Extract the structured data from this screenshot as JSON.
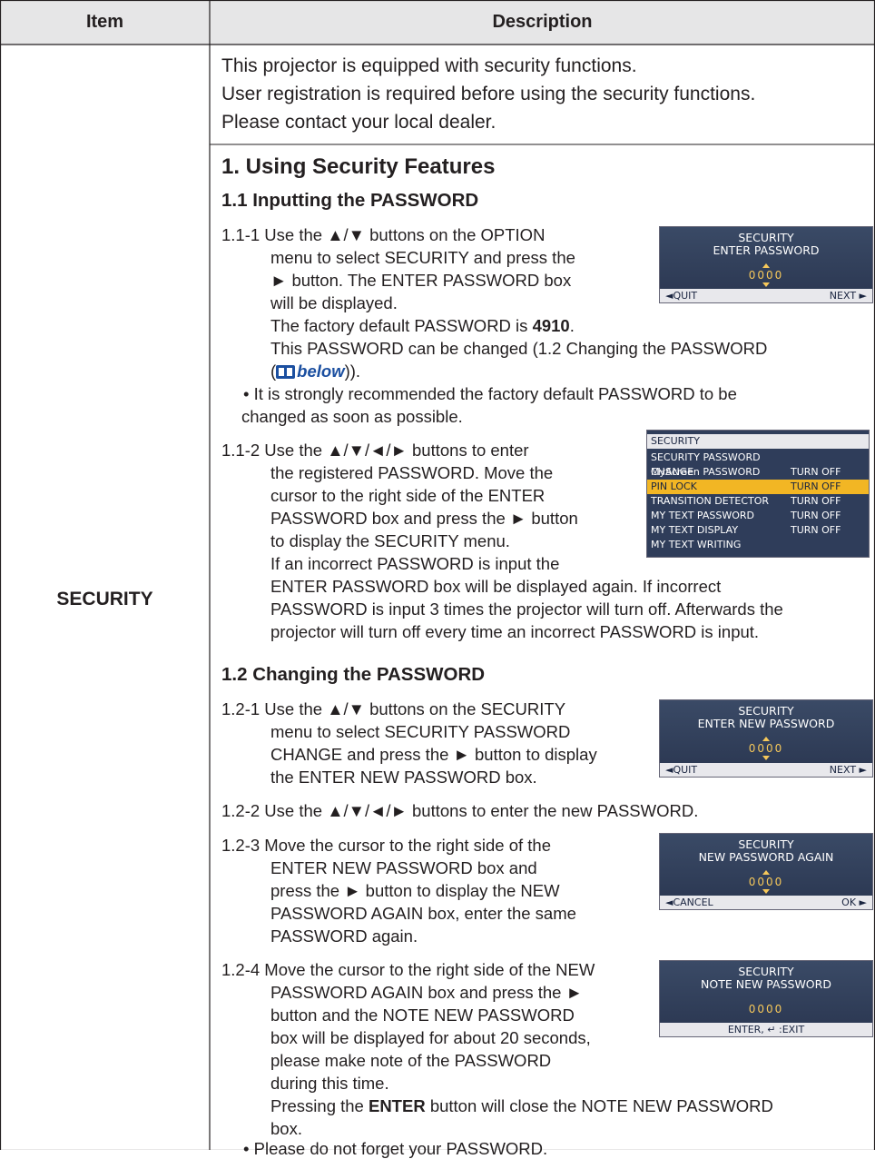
{
  "table": {
    "header_item": "Item",
    "header_description": "Description",
    "item": "SECURITY"
  },
  "intro": [
    "This projector is equipped with security functions.",
    "User registration is required before using the security functions.",
    "Please contact your local dealer."
  ],
  "section1_title": "1. Using Security Features",
  "sub11_title": "1.1 Inputting the PASSWORD",
  "p111": [
    "1.1-1 Use the ▲/▼ buttons on the OPTION",
    "menu to select SECURITY and press the",
    "► button. The ENTER PASSWORD box",
    "will be displayed.",
    "The factory default PASSWORD is ",
    "4910",
    ".",
    "This PASSWORD can be changed (1.2 Changing the PASSWORD",
    "(",
    "below",
    "))."
  ],
  "note1": [
    "• It is strongly recommended the factory default PASSWORD to be",
    "changed as soon as possible."
  ],
  "p112": [
    "1.1-2 Use the ▲/▼/◄/► buttons to enter",
    "the registered PASSWORD. Move the",
    "cursor to the right side of the ENTER",
    "PASSWORD box and press the ► button",
    "to display the SECURITY menu.",
    "If an incorrect PASSWORD is input the",
    "ENTER PASSWORD box will be displayed again. If incorrect",
    "PASSWORD is input 3 times the projector will turn off. Afterwards the",
    "projector will turn off every time an incorrect PASSWORD is input."
  ],
  "sub12_title": "1.2 Changing the PASSWORD",
  "p121": [
    "1.2-1 Use the ▲/▼ buttons on the SECURITY",
    "menu to select SECURITY PASSWORD",
    "CHANGE and press the ► button to display",
    "the ENTER NEW PASSWORD box."
  ],
  "p122": [
    "1.2-2 Use the ▲/▼/◄/► buttons to enter the new PASSWORD."
  ],
  "p123": [
    "1.2-3 Move the cursor to the right side of the",
    "ENTER NEW PASSWORD box and",
    "press the ► button to display the NEW",
    "PASSWORD AGAIN box, enter the same",
    "PASSWORD again."
  ],
  "p124": [
    "1.2-4 Move the cursor to the right side of the NEW",
    "PASSWORD AGAIN box and press the ►",
    "button and the NOTE NEW PASSWORD",
    "box will be displayed for about 20 seconds,",
    "please make note of the PASSWORD",
    "during this time.",
    "Pressing the ",
    "ENTER",
    " button will close the NOTE NEW PASSWORD",
    "box.",
    "• Please do not forget your PASSWORD."
  ],
  "osd1": {
    "line1": "SECURITY",
    "line2": "ENTER PASSWORD",
    "code": "0000",
    "left": "◄QUIT",
    "right": "NEXT ►"
  },
  "menu": {
    "title": "SECURITY",
    "rows": [
      {
        "label": "SECURITY PASSWORD CHANGE",
        "value": ""
      },
      {
        "label": "MyScreen PASSWORD",
        "value": "TURN OFF"
      },
      {
        "label": "PIN LOCK",
        "value": "TURN OFF"
      },
      {
        "label": "TRANSITION DETECTOR",
        "value": "TURN OFF"
      },
      {
        "label": "MY TEXT PASSWORD",
        "value": "TURN OFF"
      },
      {
        "label": "MY TEXT DISPLAY",
        "value": "TURN OFF"
      },
      {
        "label": "MY TEXT WRITING",
        "value": ""
      }
    ]
  },
  "osd2": {
    "line1": "SECURITY",
    "line2": "ENTER NEW PASSWORD",
    "code": "0000",
    "left": "◄QUIT",
    "right": "NEXT ►"
  },
  "osd3": {
    "line1": "SECURITY",
    "line2": "NEW PASSWORD AGAIN",
    "code": "0000",
    "left": "◄CANCEL",
    "right": "OK ►"
  },
  "osd4": {
    "line1": "SECURITY",
    "line2": "NOTE NEW PASSWORD",
    "code": "0000",
    "footer": "ENTER, ↵ :EXIT"
  }
}
